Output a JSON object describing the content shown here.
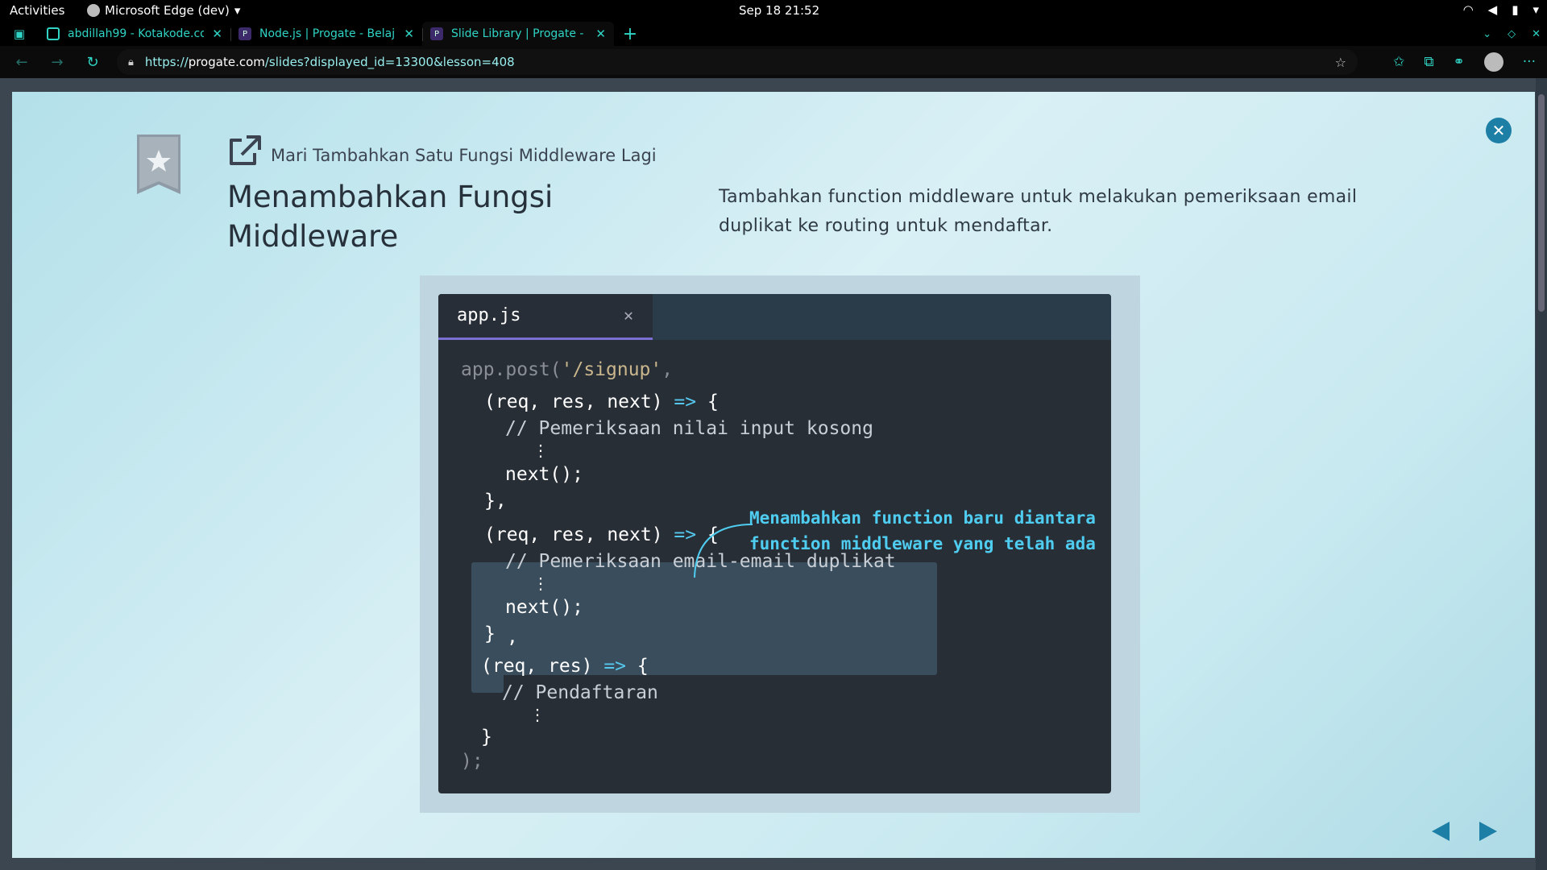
{
  "system": {
    "activities": "Activities",
    "app_name": "Microsoft Edge (dev)",
    "clock": "Sep 18  21:52"
  },
  "browser": {
    "tabs": [
      {
        "title": "abdillah99 - Kotakode.com",
        "favicon": "kotakode-favicon"
      },
      {
        "title": "Node.js | Progate - Belajar",
        "favicon": "progate-favicon"
      },
      {
        "title": "Slide Library | Progate - Belajar",
        "favicon": "progate-favicon"
      }
    ],
    "url_prefix": "https://",
    "url_host": "progate.com",
    "url_path": "/slides?displayed_id=13300&lesson=408"
  },
  "slide": {
    "subtitle": "Mari Tambahkan Satu Fungsi Middleware Lagi",
    "title": "Menambahkan Fungsi Middleware",
    "description": "Tambahkan function middleware untuk melakukan pemeriksaan email duplikat ke routing untuk mendaftar.",
    "editor": {
      "filename": "app.js",
      "close_glyph": "✕",
      "code": {
        "l1_fn": "app.post(",
        "l1_str": "'/signup'",
        "l1_end": ",",
        "l2_a": "(req, res, next) ",
        "l2_arrow": "=>",
        "l2_b": " {",
        "l3": "// Pemeriksaan nilai input kosong",
        "ellipsis": "⋮",
        "l5": "next();",
        "l6": "},",
        "l7_a": "(req, res, next) ",
        "l7_arrow": "=>",
        "l7_b": " {",
        "l8": "// Pemeriksaan email-email duplikat",
        "l10": "next();",
        "l11": "}",
        "l11_comma": ",",
        "l12_a": "(req, res) ",
        "l12_arrow": "=>",
        "l12_b": " {",
        "l13": "// Pendaftaran",
        "l15": "}",
        "l16": ");"
      },
      "annotation": "Menambahkan function baru diantara function middleware yang telah ada"
    }
  }
}
